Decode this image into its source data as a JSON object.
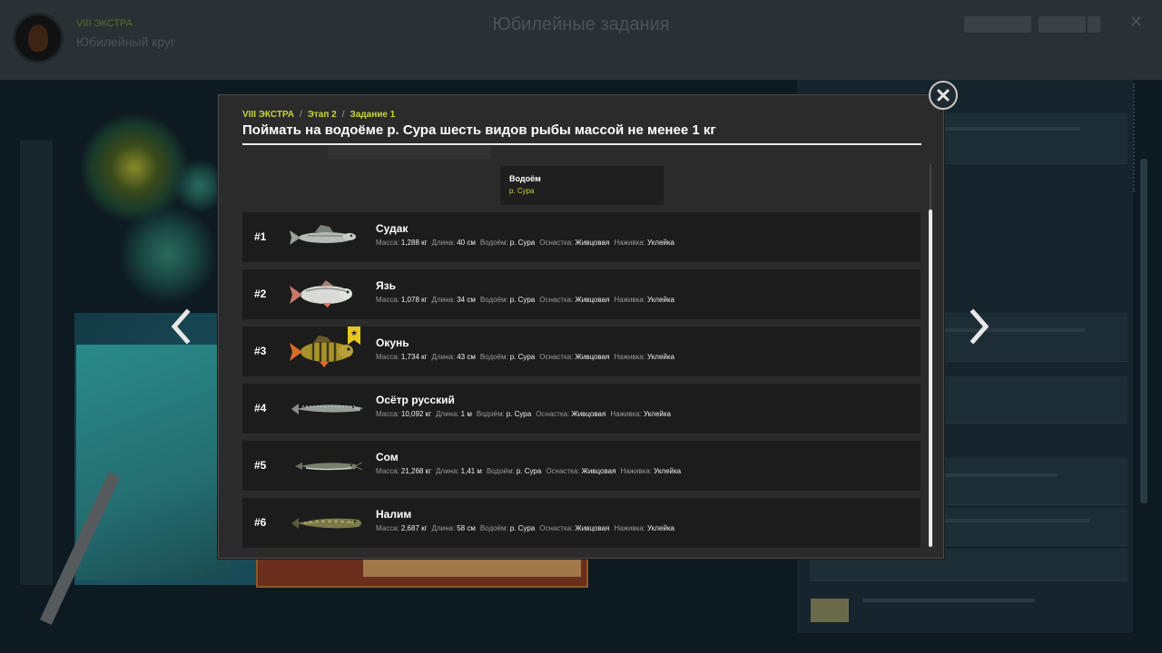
{
  "background": {
    "player_rank": "VIII ЭКСТРА",
    "player_name": "Юбилейный круг",
    "screen_title": "Юбилейные задания"
  },
  "breadcrumb": [
    "VIII ЭКСТРА",
    "Этап 2",
    "Задание 1"
  ],
  "task_title": "Поймать на водоёме р. Сура шесть видов рыбы массой не менее 1 кг",
  "filter": {
    "label": "Водоём",
    "value": "р. Сура"
  },
  "stat_labels": {
    "mass": "Масса:",
    "length": "Длина:",
    "water": "Водоём:",
    "tackle": "Оснастка:",
    "bait": "Наживка:"
  },
  "fish": [
    {
      "rank": "#1",
      "name": "Судак",
      "mass": "1,288 кг",
      "length": "40 см",
      "water": "р. Сура",
      "tackle": "Живцовая",
      "bait": "Уклейка",
      "icon": "zander-fish-icon",
      "trophy": false
    },
    {
      "rank": "#2",
      "name": "Язь",
      "mass": "1,078 кг",
      "length": "34 см",
      "water": "р. Сура",
      "tackle": "Живцовая",
      "bait": "Уклейка",
      "icon": "ide-fish-icon",
      "trophy": false
    },
    {
      "rank": "#3",
      "name": "Окунь",
      "mass": "1,734 кг",
      "length": "43 см",
      "water": "р. Сура",
      "tackle": "Живцовая",
      "bait": "Уклейка",
      "icon": "perch-fish-icon",
      "trophy": true
    },
    {
      "rank": "#4",
      "name": "Осётр русский",
      "mass": "10,092 кг",
      "length": "1 м",
      "water": "р. Сура",
      "tackle": "Живцовая",
      "bait": "Уклейка",
      "icon": "sturgeon-fish-icon",
      "trophy": false
    },
    {
      "rank": "#5",
      "name": "Сом",
      "mass": "21,268 кг",
      "length": "1,41 м",
      "water": "р. Сура",
      "tackle": "Живцовая",
      "bait": "Уклейка",
      "icon": "catfish-fish-icon",
      "trophy": false
    },
    {
      "rank": "#6",
      "name": "Налим",
      "mass": "2,687 кг",
      "length": "58 см",
      "water": "р. Сура",
      "tackle": "Живцовая",
      "bait": "Уклейка",
      "icon": "burbot-fish-icon",
      "trophy": false
    }
  ],
  "colors": {
    "accent": "#c8d43a",
    "row_bg": "#1c1c1c",
    "modal_bg": "#2b2b2b",
    "trophy": "#e8c820"
  }
}
